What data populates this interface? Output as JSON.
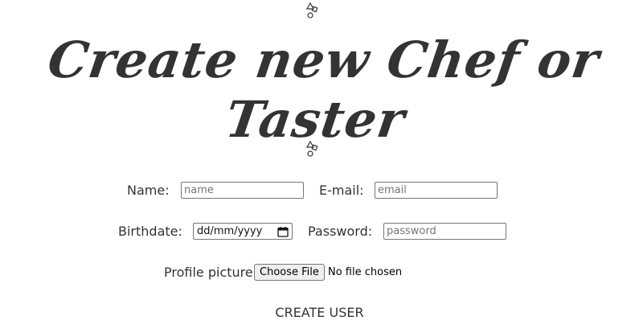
{
  "header": {
    "title": "Create new Chef or Taster",
    "logo_icon": "shapes-icon"
  },
  "form": {
    "name_label": "Name:",
    "name_placeholder": "name",
    "email_label": "E-mail:",
    "email_placeholder": "email",
    "birthdate_label": "Birthdate:",
    "birthdate_value": "dd/mm/yyyy",
    "password_label": "Password:",
    "password_placeholder": "password",
    "picture_label": "Profile picture:",
    "file_button_label": "Choose File",
    "file_status": "No file chosen",
    "submit_label": "CREATE USER"
  }
}
